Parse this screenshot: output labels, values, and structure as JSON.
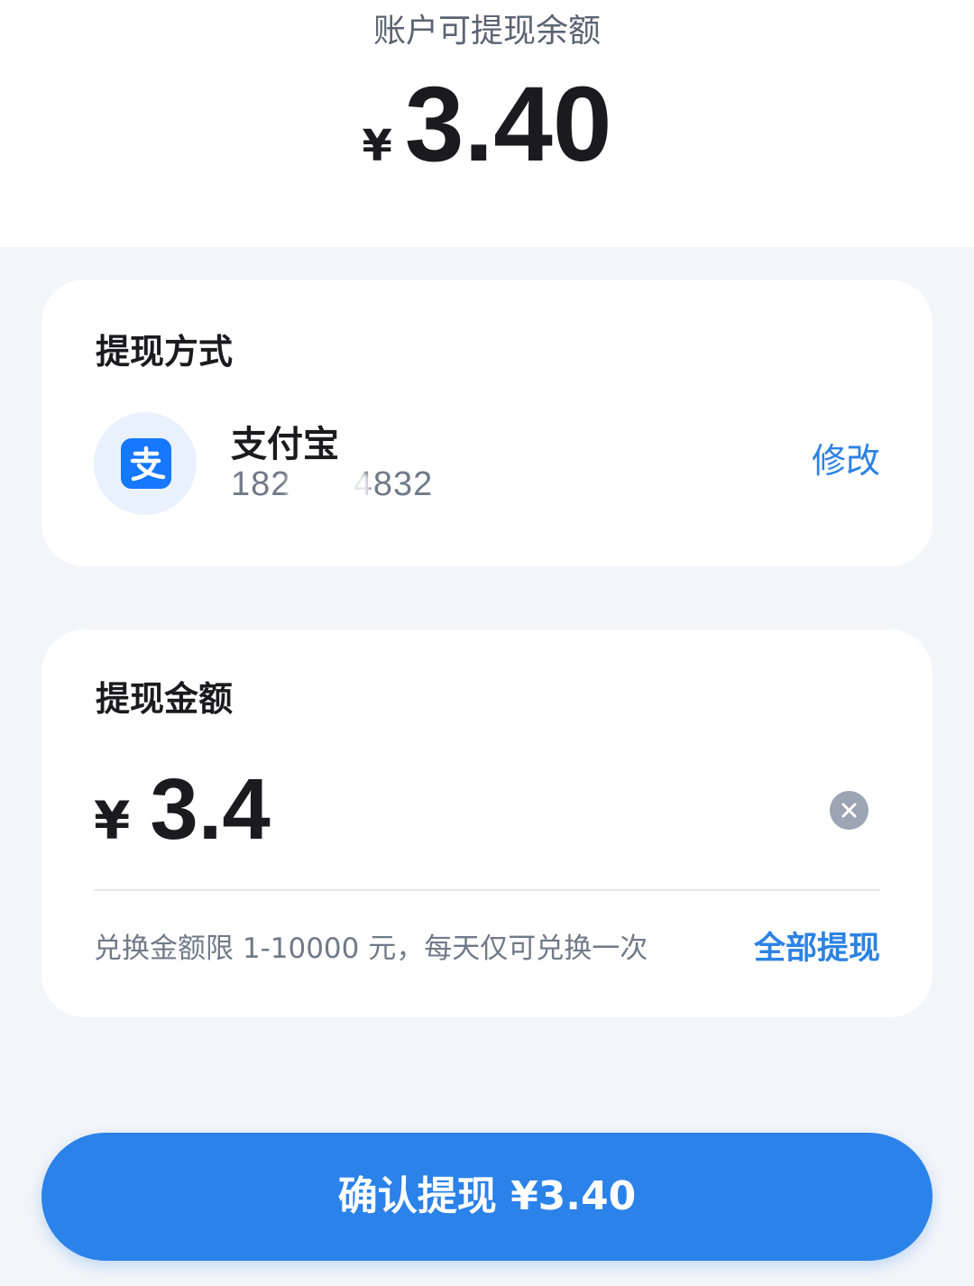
{
  "header": {
    "balance_label": "账户可提现余额",
    "currency_symbol": "¥",
    "balance": "3.40"
  },
  "method_card": {
    "title": "提现方式",
    "icon": "alipay-icon",
    "provider_name": "支付宝",
    "account": "182      4832",
    "modify_label": "修改"
  },
  "amount_card": {
    "title": "提现金额",
    "currency_symbol": "¥",
    "amount_value": "3.4",
    "clear_icon": "clear-icon",
    "limit_text": "兑换金额限 1-10000 元，每天仅可兑换一次",
    "withdraw_all_label": "全部提现"
  },
  "confirm": {
    "label": "确认提现",
    "amount": "¥3.40"
  },
  "colors": {
    "accent": "#2b82e4",
    "button": "#2b82e9",
    "alipay": "#1677ff",
    "background": "#f3f5f9"
  }
}
